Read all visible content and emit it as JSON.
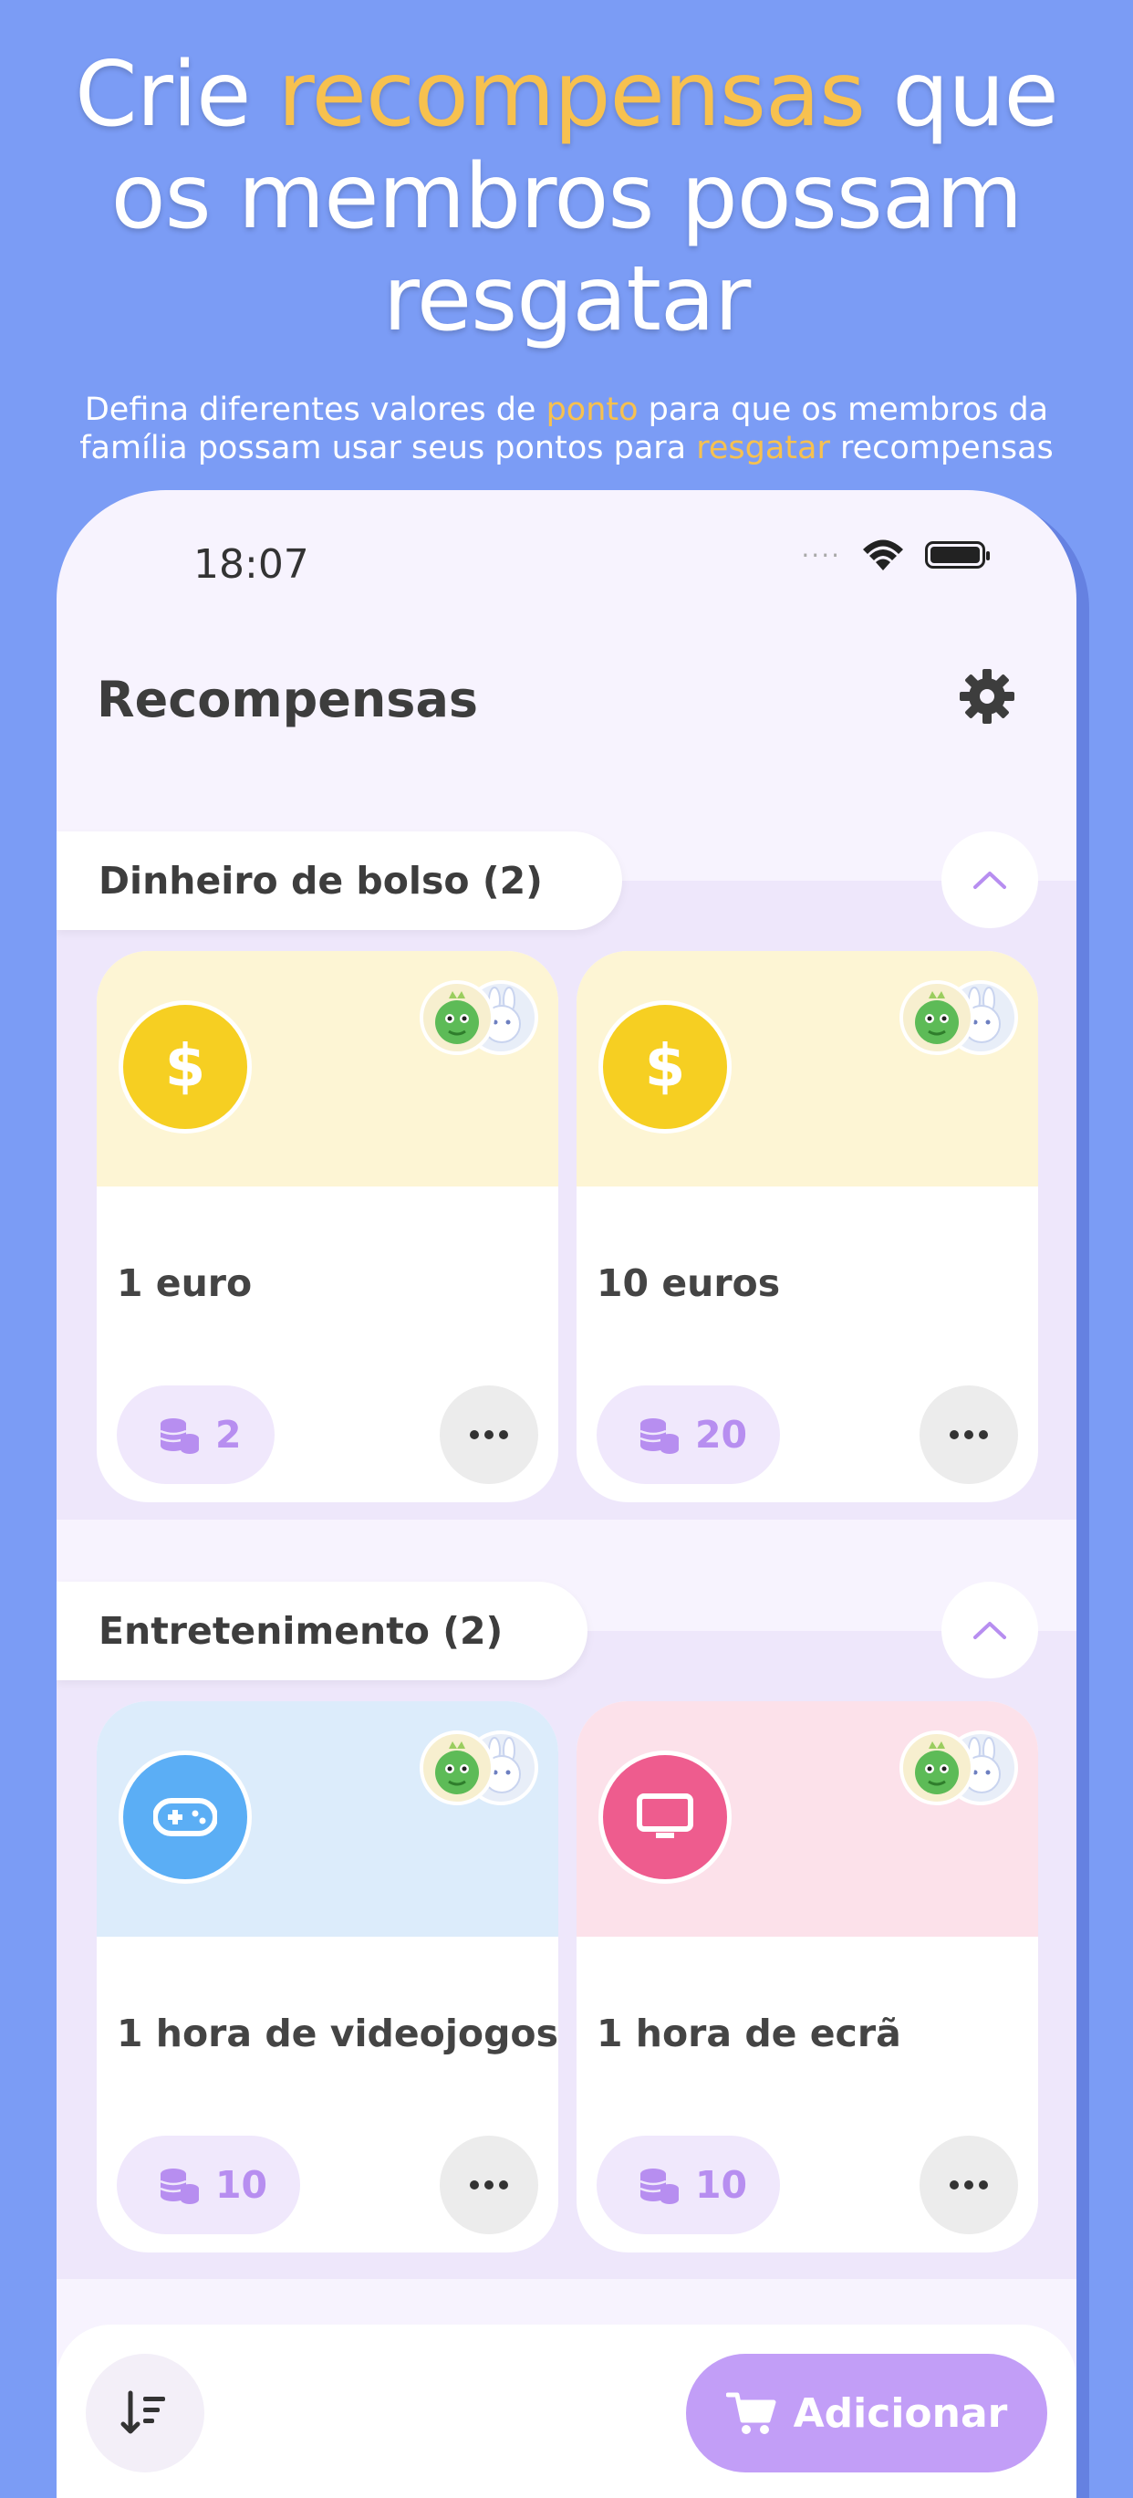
{
  "promo": {
    "headline_part1": "Crie ",
    "headline_highlight": "recompensas",
    "headline_part2": " que os membros possam resgatar",
    "subline_part1": "Defina diferentes valores de ",
    "subline_highlight1": "ponto",
    "subline_part2": " para que os membros da família possam usar seus pontos para ",
    "subline_highlight2": "resgatar",
    "subline_part3": " recompensas"
  },
  "status_bar": {
    "time": "18:07",
    "signal": "····"
  },
  "header": {
    "title": "Recompensas",
    "settings_icon": "gear-icon"
  },
  "sections": [
    {
      "title": "Dinheiro de bolso (2)",
      "items": [
        {
          "name": "1 euro",
          "points": "2",
          "icon": "dollar-icon",
          "icon_glyph": "$"
        },
        {
          "name": "10 euros",
          "points": "20",
          "icon": "dollar-icon",
          "icon_glyph": "$"
        }
      ]
    },
    {
      "title": "Entretenimento (2)",
      "items": [
        {
          "name": "1 hora de videojogos",
          "points": "10",
          "icon": "gamepad-icon"
        },
        {
          "name": "1 hora de ecrã",
          "points": "10",
          "icon": "tv-icon"
        }
      ]
    }
  ],
  "bottom_bar": {
    "add_label": "Adicionar",
    "sort_icon": "sort-icon"
  },
  "colors": {
    "background": "#7b9cf5",
    "highlight": "#f7c14f",
    "accent": "#c29ef7",
    "money_card": "#fdf5d4",
    "game_card": "#dcecfb",
    "tv_card": "#fce1ea",
    "dollar": "#f6cf22",
    "game": "#5baef5",
    "tv": "#ee5c8e"
  }
}
